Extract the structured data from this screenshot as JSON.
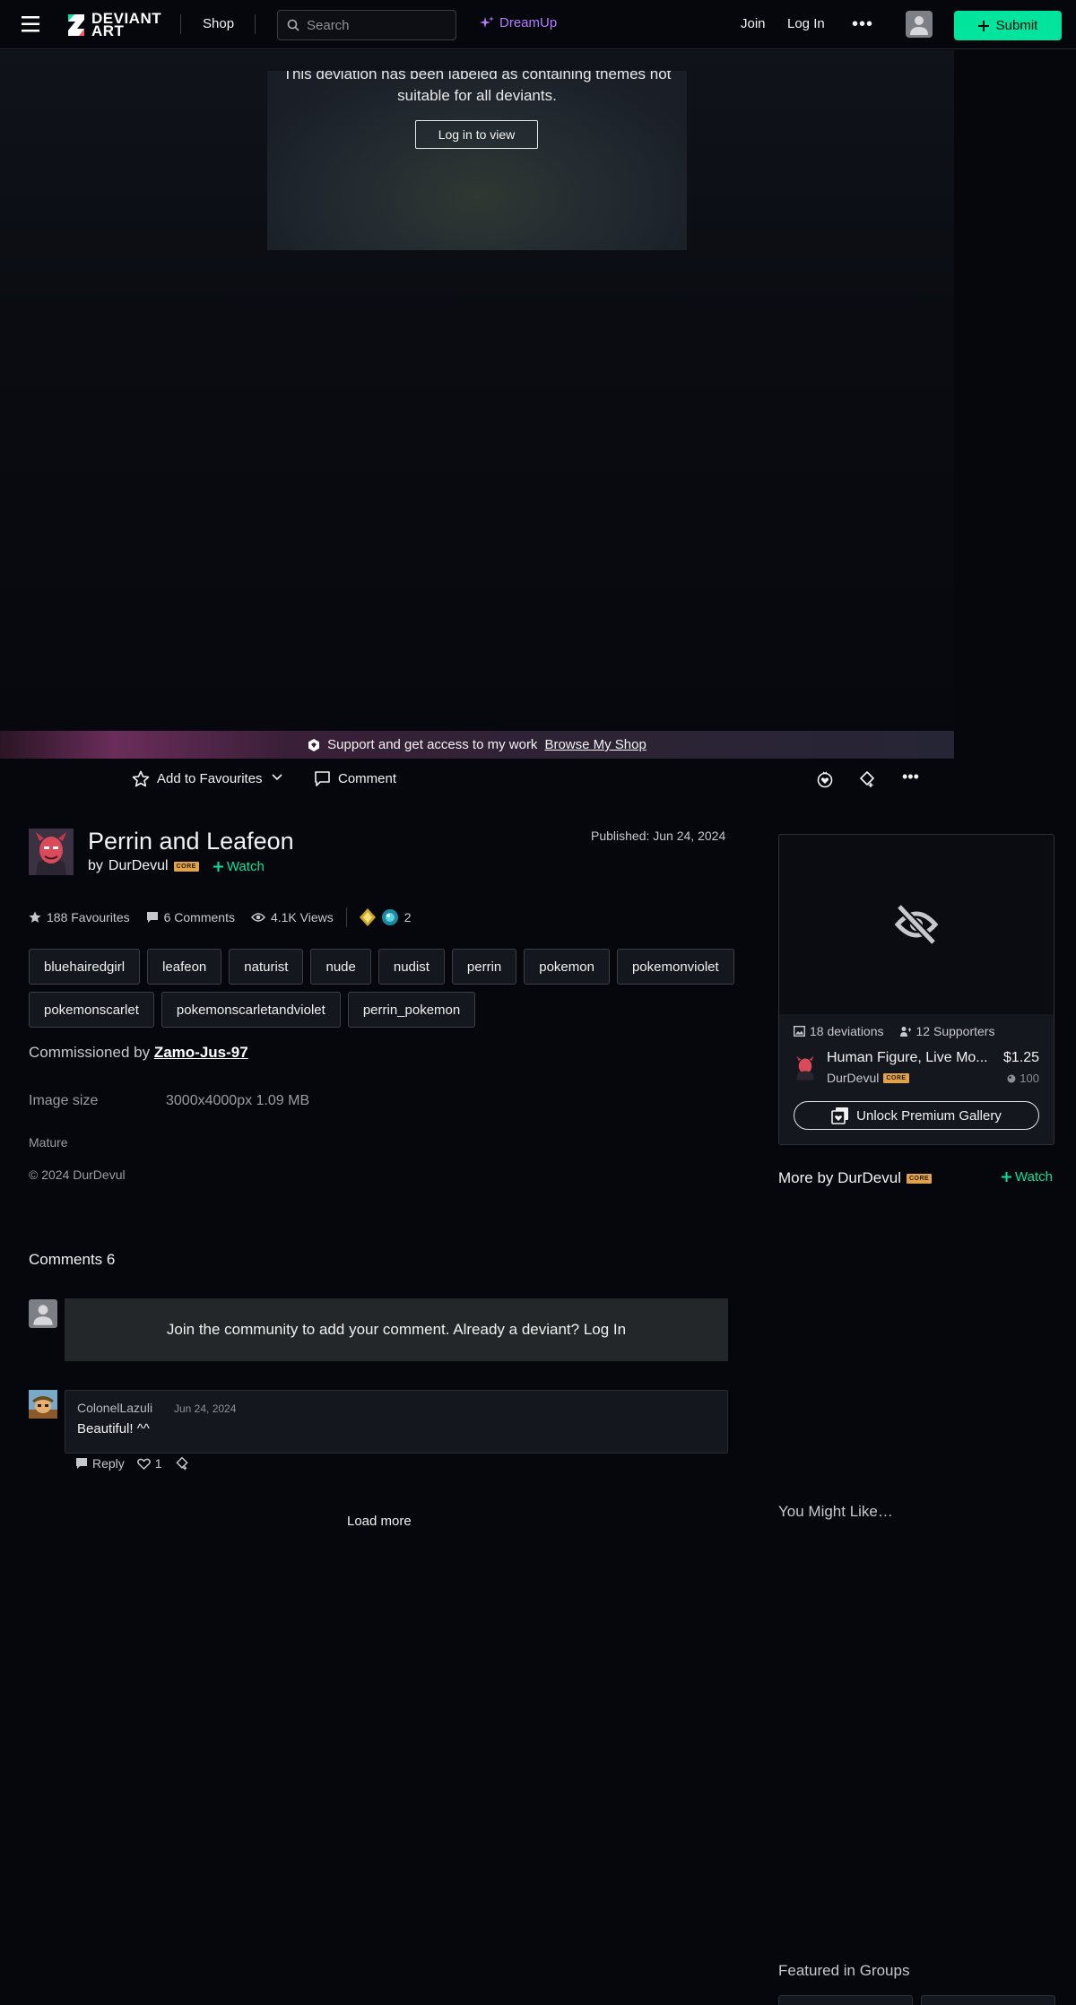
{
  "header": {
    "logo_text_line1": "DEVIANT",
    "logo_text_line2": "ART",
    "shop": "Shop",
    "search_placeholder": "Search",
    "dreamup": "DreamUp",
    "join": "Join",
    "login": "Log In",
    "more": "•••",
    "submit": "Submit"
  },
  "stage": {
    "mature_message_line1": "This deviation has been labeled as containing themes not",
    "mature_message_line2": "suitable for all deviants.",
    "login_to_view": "Log in to view"
  },
  "banner": {
    "text": "Support and get access to my work",
    "link": "Browse My Shop"
  },
  "actions": {
    "favourite": "Add to Favourites",
    "comment": "Comment"
  },
  "deviation": {
    "title": "Perrin and Leafeon",
    "by": "by",
    "artist": "DurDevul",
    "core": "CORE",
    "watch": "Watch",
    "published": "Published: Jun 24, 2024",
    "favourites": "188 Favourites",
    "comments": "6 Comments",
    "views": "4.1K Views",
    "awards_count": "2",
    "tags": [
      "bluehairedgirl",
      "leafeon",
      "naturist",
      "nude",
      "nudist",
      "perrin",
      "pokemon",
      "pokemonviolet",
      "pokemonscarlet",
      "pokemonscarletandviolet",
      "perrin_pokemon"
    ],
    "commissioned_prefix": "Commissioned by",
    "commissioned_by": "Zamo-Jus-97",
    "image_size_label": "Image size",
    "image_size_value": "3000x4000px 1.09 MB",
    "mature": "Mature",
    "copyright": "© 2024 DurDevul"
  },
  "comments": {
    "heading": "Comments 6",
    "join_prompt": "Join the community to add your comment. Already a deviant? Log In",
    "items": [
      {
        "author": "ColonelLazuli",
        "date": "Jun 24, 2024",
        "text": "Beautiful! ^^",
        "likes": "1"
      }
    ],
    "reply": "Reply",
    "load_more": "Load more"
  },
  "sidebar": {
    "deviations": "18 deviations",
    "supporters": "12 Supporters",
    "gallery_name": "Human Figure, Live Mo...",
    "gallery_author": "DurDevul",
    "core": "CORE",
    "price": "$1.25",
    "points": "100",
    "unlock": "Unlock Premium Gallery",
    "more_by": "More by DurDevul",
    "watch": "Watch",
    "might_like": "You Might Like…",
    "featured": "Featured in Groups"
  },
  "colors": {
    "background": "#06070d",
    "accent_green": "#00e59b",
    "dreamup_purple": "#b57cff",
    "core_badge": "#e0a24a"
  }
}
